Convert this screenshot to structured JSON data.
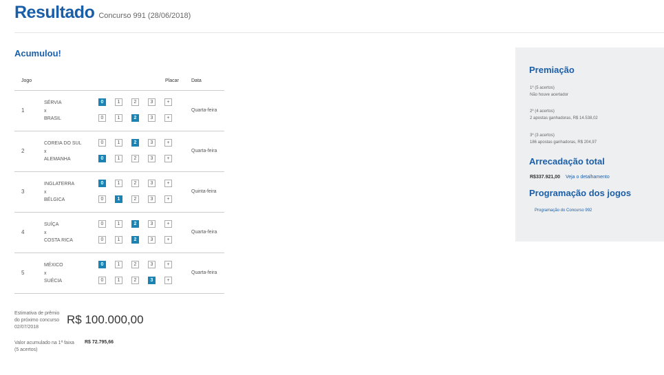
{
  "header": {
    "title": "Resultado",
    "subtitle": "Concurso 991 (28/06/2018)"
  },
  "status": "Acumulou!",
  "table": {
    "headers": {
      "jogo": "Jogo",
      "placar": "Placar",
      "data": "Data"
    },
    "vs": "x",
    "score_options": [
      "0",
      "1",
      "2",
      "3",
      "+"
    ],
    "rows": [
      {
        "num": "1",
        "team1": "SÉRVIA",
        "team2": "BRASIL",
        "sel1": 0,
        "sel2": 2,
        "date": "Quarta-feira"
      },
      {
        "num": "2",
        "team1": "COREIA DO SUL",
        "team2": "ALEMANHA",
        "sel1": 2,
        "sel2": 0,
        "date": "Quarta-feira"
      },
      {
        "num": "3",
        "team1": "INGLATERRA",
        "team2": "BÉLGICA",
        "sel1": 0,
        "sel2": 1,
        "date": "Quinta-feira"
      },
      {
        "num": "4",
        "team1": "SUÍÇA",
        "team2": "COSTA RICA",
        "sel1": 2,
        "sel2": 2,
        "date": "Quarta-feira"
      },
      {
        "num": "5",
        "team1": "MÉXICO",
        "team2": "SUÉCIA",
        "sel1": 0,
        "sel2": 3,
        "date": "Quarta-feira"
      }
    ]
  },
  "estimate": {
    "label_line1": "Estimativa de prêmio",
    "label_line2": "do próximo concurso",
    "label_line3": "02/07/2018",
    "value": "R$ 100.000,00"
  },
  "accumulated": {
    "label_line1": "Valor acumulado na 1ª faixa",
    "label_line2": "(5 acertos)",
    "value": "R$ 72.795,66"
  },
  "sidebar": {
    "premiacao_title": "Premiação",
    "prizes": [
      {
        "line1": "1º (5 acertos)",
        "line2": "Não houve acertador"
      },
      {
        "line1": "2º (4 acertos)",
        "line2": "2 apostas ganhadoras, R$ 14.538,02"
      },
      {
        "line1": "3º (3 acertos)",
        "line2": "186 apostas ganhadoras, R$ 204,97"
      }
    ],
    "arrecadacao_title": "Arrecadação total",
    "arrecadacao_value": "R$337.921,00",
    "detail_link": "Veja o detalhamento",
    "programacao_title": "Programação dos jogos",
    "programacao_link": "Programação do Concurso 992"
  },
  "colors": {
    "brand": "#1a5ea8",
    "selected": "#1b82b4",
    "sidebar_bg": "#eeeff1"
  }
}
